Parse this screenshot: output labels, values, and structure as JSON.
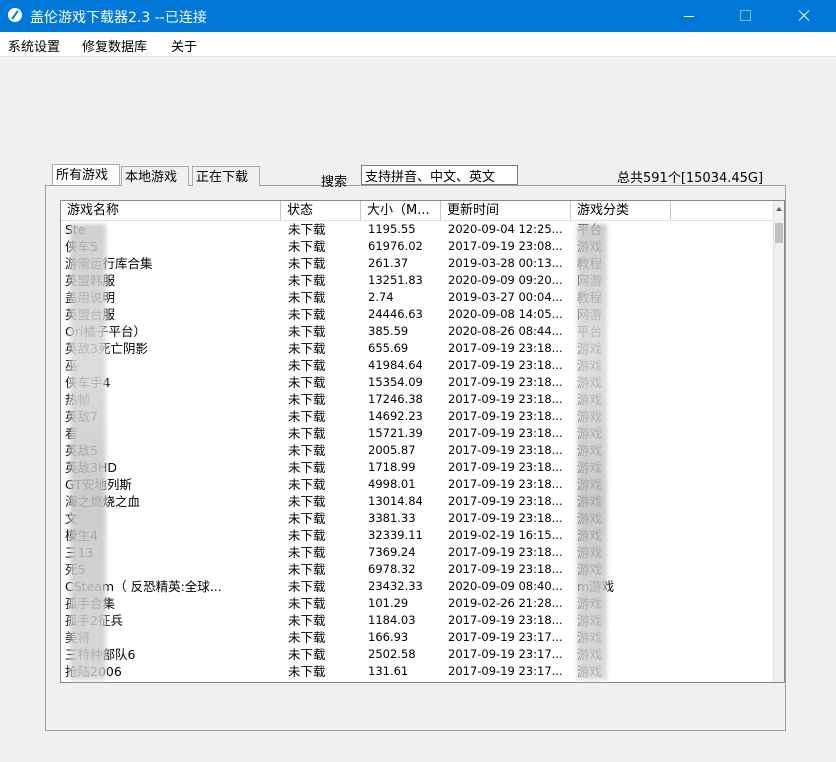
{
  "window": {
    "title": "盖伦游戏下载器2.3 --已连接"
  },
  "menu": [
    "系统设置",
    "修复数据库",
    "关于"
  ],
  "tabs": [
    "所有游戏",
    "本地游戏",
    "正在下载"
  ],
  "search": {
    "label": "搜索",
    "value": "支持拼音、中文、英文"
  },
  "total": "总共591个[15034.45G]",
  "columns": [
    "游戏名称",
    "状态",
    "大小（M...",
    "更新时间",
    "游戏分类"
  ],
  "rows": [
    {
      "name": "Ste",
      "status": "未下载",
      "size": "1195.55",
      "time": "2020-09-04 12:25...",
      "cat": "平台"
    },
    {
      "name": "侠车5",
      "status": "未下载",
      "size": "61976.02",
      "time": "2017-09-19 23:08...",
      "cat": "游戏"
    },
    {
      "name": "游需运行库合集",
      "status": "未下载",
      "size": "261.37",
      "time": "2019-03-28 00:13...",
      "cat": "教程"
    },
    {
      "name": "英盟韩服",
      "status": "未下载",
      "size": "13251.83",
      "time": "2020-09-09 09:20...",
      "cat": "网游"
    },
    {
      "name": "盖用说明",
      "status": "未下载",
      "size": "2.74",
      "time": "2019-03-27 00:04...",
      "cat": "教程"
    },
    {
      "name": "英盟台服",
      "status": "未下载",
      "size": "24446.63",
      "time": "2020-09-08 14:05...",
      "cat": "网游"
    },
    {
      "name": "Ori橘子平台）",
      "status": "未下载",
      "size": "385.59",
      "time": "2020-08-26 08:44...",
      "cat": "平台"
    },
    {
      "name": "英敌3死亡阴影",
      "status": "未下载",
      "size": "655.69",
      "time": "2017-09-19 23:18...",
      "cat": "游戏"
    },
    {
      "name": "巫",
      "status": "未下载",
      "size": "41984.64",
      "time": "2017-09-19 23:18...",
      "cat": "游戏"
    },
    {
      "name": "侠车手4",
      "status": "未下载",
      "size": "15354.09",
      "time": "2017-09-19 23:18...",
      "cat": "游戏"
    },
    {
      "name": "热帧",
      "status": "未下载",
      "size": "17246.38",
      "time": "2017-09-19 23:18...",
      "cat": "游戏"
    },
    {
      "name": "英敌7",
      "status": "未下载",
      "size": "14692.23",
      "time": "2017-09-19 23:18...",
      "cat": "游戏"
    },
    {
      "name": "看",
      "status": "未下载",
      "size": "15721.39",
      "time": "2017-09-19 23:18...",
      "cat": "游戏"
    },
    {
      "name": "英敌5",
      "status": "未下载",
      "size": "2005.87",
      "time": "2017-09-19 23:18...",
      "cat": "游戏"
    },
    {
      "name": "英敌3HD",
      "status": "未下载",
      "size": "1718.99",
      "time": "2017-09-19 23:18...",
      "cat": "游戏"
    },
    {
      "name": "GT安地列斯",
      "status": "未下载",
      "size": "4998.01",
      "time": "2017-09-19 23:18...",
      "cat": "游戏"
    },
    {
      "name": "海之燃烧之血",
      "status": "未下载",
      "size": "13014.84",
      "time": "2017-09-19 23:18...",
      "cat": "游戏"
    },
    {
      "name": "文",
      "status": "未下载",
      "size": "3381.33",
      "time": "2017-09-19 23:18...",
      "cat": "游戏"
    },
    {
      "name": "模生4",
      "status": "未下载",
      "size": "32339.11",
      "time": "2019-02-19 16:15...",
      "cat": "游戏"
    },
    {
      "name": "三13",
      "status": "未下载",
      "size": "7369.24",
      "time": "2017-09-19 23:18...",
      "cat": "游戏"
    },
    {
      "name": "死5",
      "status": "未下载",
      "size": "6978.32",
      "time": "2017-09-19 23:18...",
      "cat": "游戏"
    },
    {
      "name": "CSteam（ 反恐精英:全球...",
      "status": "未下载",
      "size": "23432.33",
      "time": "2020-09-09 08:40...",
      "cat": "m游戏"
    },
    {
      "name": "孤手合集",
      "status": "未下载",
      "size": "101.29",
      "time": "2019-02-26 21:28...",
      "cat": "游戏"
    },
    {
      "name": "孤手2征兵",
      "status": "未下载",
      "size": "1184.03",
      "time": "2017-09-19 23:18...",
      "cat": "游戏"
    },
    {
      "name": "美将",
      "status": "未下载",
      "size": "166.93",
      "time": "2017-09-19 23:17...",
      "cat": "游戏"
    },
    {
      "name": "三特种部队6",
      "status": "未下载",
      "size": "2502.58",
      "time": "2017-09-19 23:17...",
      "cat": "游戏"
    },
    {
      "name": "抢陆2006",
      "status": "未下载",
      "size": "131.61",
      "time": "2017-09-19 23:17...",
      "cat": "游戏"
    }
  ]
}
